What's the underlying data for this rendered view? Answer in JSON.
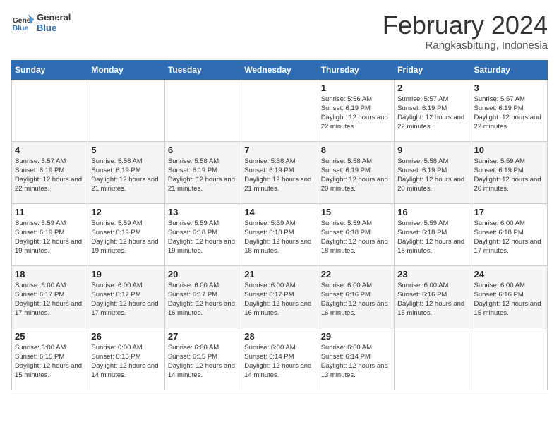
{
  "header": {
    "logo_general": "General",
    "logo_blue": "Blue",
    "month_year": "February 2024",
    "location": "Rangkasbitung, Indonesia"
  },
  "days_of_week": [
    "Sunday",
    "Monday",
    "Tuesday",
    "Wednesday",
    "Thursday",
    "Friday",
    "Saturday"
  ],
  "weeks": [
    [
      {
        "day": "",
        "info": ""
      },
      {
        "day": "",
        "info": ""
      },
      {
        "day": "",
        "info": ""
      },
      {
        "day": "",
        "info": ""
      },
      {
        "day": "1",
        "info": "Sunrise: 5:56 AM\nSunset: 6:19 PM\nDaylight: 12 hours and 22 minutes."
      },
      {
        "day": "2",
        "info": "Sunrise: 5:57 AM\nSunset: 6:19 PM\nDaylight: 12 hours and 22 minutes."
      },
      {
        "day": "3",
        "info": "Sunrise: 5:57 AM\nSunset: 6:19 PM\nDaylight: 12 hours and 22 minutes."
      }
    ],
    [
      {
        "day": "4",
        "info": "Sunrise: 5:57 AM\nSunset: 6:19 PM\nDaylight: 12 hours and 22 minutes."
      },
      {
        "day": "5",
        "info": "Sunrise: 5:58 AM\nSunset: 6:19 PM\nDaylight: 12 hours and 21 minutes."
      },
      {
        "day": "6",
        "info": "Sunrise: 5:58 AM\nSunset: 6:19 PM\nDaylight: 12 hours and 21 minutes."
      },
      {
        "day": "7",
        "info": "Sunrise: 5:58 AM\nSunset: 6:19 PM\nDaylight: 12 hours and 21 minutes."
      },
      {
        "day": "8",
        "info": "Sunrise: 5:58 AM\nSunset: 6:19 PM\nDaylight: 12 hours and 20 minutes."
      },
      {
        "day": "9",
        "info": "Sunrise: 5:58 AM\nSunset: 6:19 PM\nDaylight: 12 hours and 20 minutes."
      },
      {
        "day": "10",
        "info": "Sunrise: 5:59 AM\nSunset: 6:19 PM\nDaylight: 12 hours and 20 minutes."
      }
    ],
    [
      {
        "day": "11",
        "info": "Sunrise: 5:59 AM\nSunset: 6:19 PM\nDaylight: 12 hours and 19 minutes."
      },
      {
        "day": "12",
        "info": "Sunrise: 5:59 AM\nSunset: 6:19 PM\nDaylight: 12 hours and 19 minutes."
      },
      {
        "day": "13",
        "info": "Sunrise: 5:59 AM\nSunset: 6:18 PM\nDaylight: 12 hours and 19 minutes."
      },
      {
        "day": "14",
        "info": "Sunrise: 5:59 AM\nSunset: 6:18 PM\nDaylight: 12 hours and 18 minutes."
      },
      {
        "day": "15",
        "info": "Sunrise: 5:59 AM\nSunset: 6:18 PM\nDaylight: 12 hours and 18 minutes."
      },
      {
        "day": "16",
        "info": "Sunrise: 5:59 AM\nSunset: 6:18 PM\nDaylight: 12 hours and 18 minutes."
      },
      {
        "day": "17",
        "info": "Sunrise: 6:00 AM\nSunset: 6:18 PM\nDaylight: 12 hours and 17 minutes."
      }
    ],
    [
      {
        "day": "18",
        "info": "Sunrise: 6:00 AM\nSunset: 6:17 PM\nDaylight: 12 hours and 17 minutes."
      },
      {
        "day": "19",
        "info": "Sunrise: 6:00 AM\nSunset: 6:17 PM\nDaylight: 12 hours and 17 minutes."
      },
      {
        "day": "20",
        "info": "Sunrise: 6:00 AM\nSunset: 6:17 PM\nDaylight: 12 hours and 16 minutes."
      },
      {
        "day": "21",
        "info": "Sunrise: 6:00 AM\nSunset: 6:17 PM\nDaylight: 12 hours and 16 minutes."
      },
      {
        "day": "22",
        "info": "Sunrise: 6:00 AM\nSunset: 6:16 PM\nDaylight: 12 hours and 16 minutes."
      },
      {
        "day": "23",
        "info": "Sunrise: 6:00 AM\nSunset: 6:16 PM\nDaylight: 12 hours and 15 minutes."
      },
      {
        "day": "24",
        "info": "Sunrise: 6:00 AM\nSunset: 6:16 PM\nDaylight: 12 hours and 15 minutes."
      }
    ],
    [
      {
        "day": "25",
        "info": "Sunrise: 6:00 AM\nSunset: 6:15 PM\nDaylight: 12 hours and 15 minutes."
      },
      {
        "day": "26",
        "info": "Sunrise: 6:00 AM\nSunset: 6:15 PM\nDaylight: 12 hours and 14 minutes."
      },
      {
        "day": "27",
        "info": "Sunrise: 6:00 AM\nSunset: 6:15 PM\nDaylight: 12 hours and 14 minutes."
      },
      {
        "day": "28",
        "info": "Sunrise: 6:00 AM\nSunset: 6:14 PM\nDaylight: 12 hours and 14 minutes."
      },
      {
        "day": "29",
        "info": "Sunrise: 6:00 AM\nSunset: 6:14 PM\nDaylight: 12 hours and 13 minutes."
      },
      {
        "day": "",
        "info": ""
      },
      {
        "day": "",
        "info": ""
      }
    ]
  ]
}
